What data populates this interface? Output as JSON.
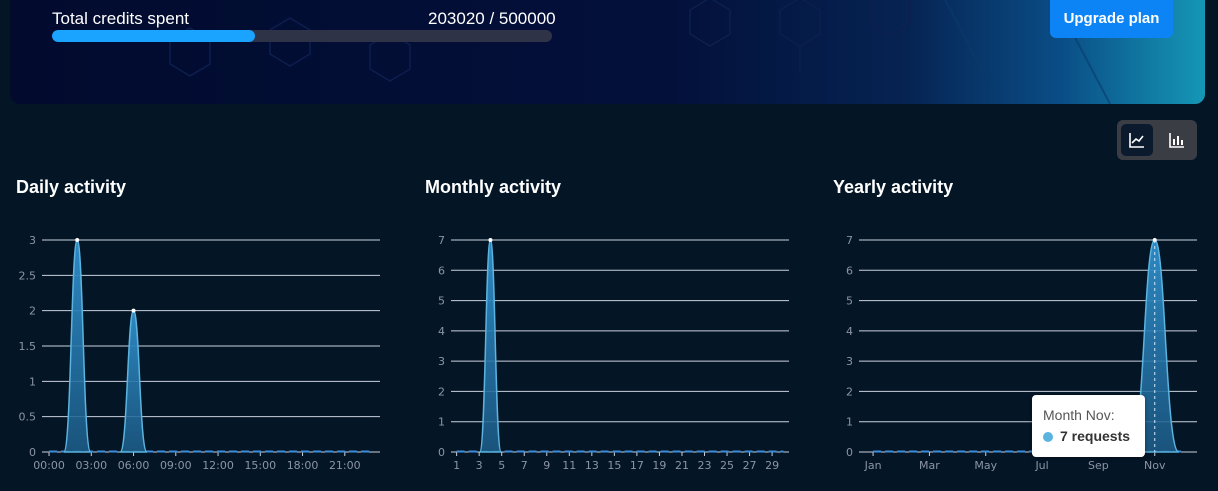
{
  "credits": {
    "label": "Total credits spent",
    "value_text": "203020 / 500000",
    "spent": 203020,
    "total": 500000
  },
  "upgrade_button": {
    "label": "Upgrade plan"
  },
  "view_toggle": {
    "options": [
      {
        "icon": "line-chart-icon",
        "active": true
      },
      {
        "icon": "bar-chart-icon",
        "active": false
      }
    ]
  },
  "colors": {
    "accent": "#1aa3ff",
    "button": "#0d84f5",
    "series_line": "#5ab4de",
    "background": "#041526"
  },
  "charts": {
    "daily": {
      "title": "Daily activity"
    },
    "monthly": {
      "title": "Monthly activity"
    },
    "yearly": {
      "title": "Yearly activity"
    }
  },
  "tooltip": {
    "title": "Month Nov:",
    "value": "7 requests"
  },
  "chart_data": [
    {
      "type": "area",
      "title": "Daily activity",
      "x_ticks": [
        "00:00",
        "03:00",
        "06:00",
        "09:00",
        "12:00",
        "15:00",
        "18:00",
        "21:00"
      ],
      "y_ticks": [
        "0",
        "0.5",
        "1",
        "1.5",
        "2",
        "2.5",
        "3"
      ],
      "ylim": [
        0,
        3
      ],
      "x_count": 24,
      "x": [
        "00:00",
        "01:00",
        "02:00",
        "03:00",
        "04:00",
        "05:00",
        "06:00",
        "07:00",
        "08:00",
        "09:00",
        "10:00",
        "11:00",
        "12:00",
        "13:00",
        "14:00",
        "15:00",
        "16:00",
        "17:00",
        "18:00",
        "19:00",
        "20:00",
        "21:00",
        "22:00",
        "23:00"
      ],
      "values": [
        0,
        0,
        3,
        0,
        0,
        0,
        2,
        0,
        0,
        0,
        0,
        0,
        0,
        0,
        0,
        0,
        0,
        0,
        0,
        0,
        0,
        0,
        0,
        0
      ],
      "grid": true
    },
    {
      "type": "area",
      "title": "Monthly activity",
      "x_ticks": [
        "1",
        "3",
        "5",
        "7",
        "9",
        "11",
        "13",
        "15",
        "17",
        "19",
        "21",
        "23",
        "25",
        "27",
        "29"
      ],
      "y_ticks": [
        "0",
        "1",
        "2",
        "3",
        "4",
        "5",
        "6",
        "7"
      ],
      "ylim": [
        0,
        7
      ],
      "x_count": 30,
      "x": [
        1,
        2,
        3,
        4,
        5,
        6,
        7,
        8,
        9,
        10,
        11,
        12,
        13,
        14,
        15,
        16,
        17,
        18,
        19,
        20,
        21,
        22,
        23,
        24,
        25,
        26,
        27,
        28,
        29,
        30
      ],
      "values": [
        0,
        0,
        0,
        7,
        0,
        0,
        0,
        0,
        0,
        0,
        0,
        0,
        0,
        0,
        0,
        0,
        0,
        0,
        0,
        0,
        0,
        0,
        0,
        0,
        0,
        0,
        0,
        0,
        0,
        0
      ],
      "grid": true
    },
    {
      "type": "area",
      "title": "Yearly activity",
      "x_ticks": [
        "Jan",
        "Mar",
        "May",
        "Jul",
        "Sep",
        "Nov"
      ],
      "y_ticks": [
        "0",
        "1",
        "2",
        "3",
        "4",
        "5",
        "6",
        "7"
      ],
      "ylim": [
        0,
        7
      ],
      "x_count": 12,
      "x": [
        "Jan",
        "Feb",
        "Mar",
        "Apr",
        "May",
        "Jun",
        "Jul",
        "Aug",
        "Sep",
        "Oct",
        "Nov",
        "Dec"
      ],
      "values": [
        0,
        0,
        0,
        0,
        0,
        0,
        0,
        0,
        0,
        0,
        7,
        0
      ],
      "grid": true
    }
  ]
}
